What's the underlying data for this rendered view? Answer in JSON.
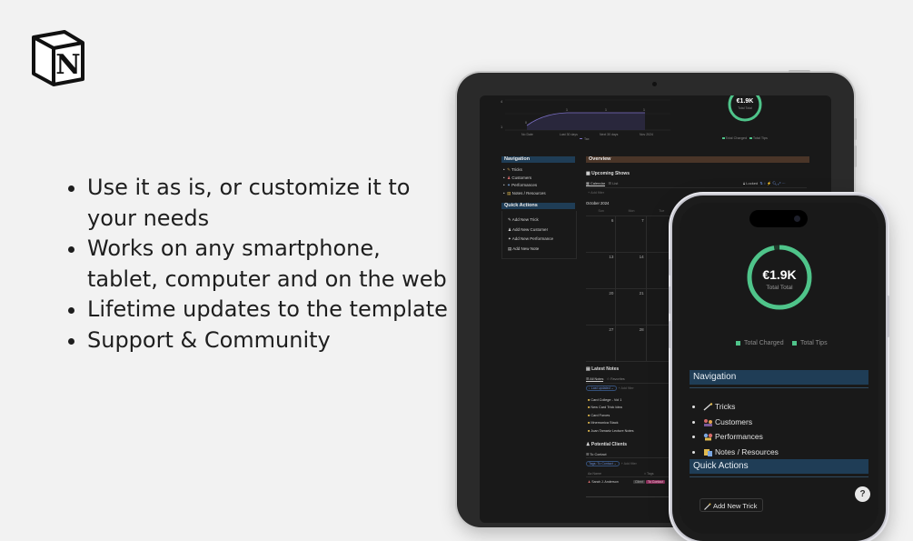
{
  "logo": {
    "icon": "notion-logo-icon",
    "letter": "N"
  },
  "bullets": [
    "Use it as is, or customize it to your needs",
    "Works on any smartphone, tablet, computer and on the web",
    "Lifetime updates to the template",
    "Support & Community"
  ],
  "colors": {
    "background": "#f2f2f2",
    "accent_green": "#4fc48a",
    "section_blue": "#1f3d56",
    "overview_brown": "#4a3528",
    "tag_pink": "#8a2e5a"
  },
  "tablet": {
    "chart": {
      "x_ticks": [
        "No Date",
        "Last 30 days",
        "Next 30 days",
        "Nov 2024"
      ],
      "y_ticks": [
        "4",
        "1"
      ],
      "point_labels": [
        "0",
        "1",
        "1",
        "1"
      ],
      "legend": "Tax"
    },
    "ring": {
      "value": "€1.9K",
      "label": "Total Total",
      "legend": [
        "Total Charged",
        "Total Tips"
      ]
    },
    "navigation": {
      "title": "Navigation",
      "items": [
        "Tricks",
        "Customers",
        "Performances",
        "Notes / Resources"
      ]
    },
    "quick_actions": {
      "title": "Quick Actions",
      "items": [
        "Add New Trick",
        "Add New Customer",
        "Add New Performance",
        "Add New Note"
      ]
    },
    "overview": {
      "title": "Overview",
      "upcoming": "Upcoming Shows",
      "view_tabs": [
        "Calendar",
        "List"
      ],
      "locked": "Locked",
      "add_filter": "+ Add filter",
      "month": "October 2024",
      "weekdays": [
        "Sun",
        "Mon",
        "Tue"
      ],
      "dates": [
        "6",
        "7",
        "",
        "13",
        "14",
        "",
        "20",
        "21",
        "",
        "27",
        "28",
        ""
      ]
    },
    "latest_notes": {
      "title": "Latest Notes",
      "tabs": [
        "All Notes",
        "Favorites"
      ],
      "filter": "Last updated",
      "add_filter": "+ Add filter",
      "items": [
        "Card College - Vol 1",
        "New Card Trick Idea",
        "Card Forces",
        "Mnemonica Stack",
        "Juan Tamariz Lecture Notes"
      ]
    },
    "potential_clients": {
      "title": "Potential Clients",
      "tab": "To Contact",
      "filter": "Tags: To Contact",
      "add_filter": "+ Add filter",
      "columns": [
        "Aa Name",
        "Tags"
      ],
      "row": {
        "name": "Sarah J. Anderson",
        "tag1": "Client",
        "tag2": "To Contact"
      }
    }
  },
  "phone": {
    "ring": {
      "value": "€1.9K",
      "label": "Total Total",
      "progress": 0.97
    },
    "legend": [
      "Total Charged",
      "Total Tips"
    ],
    "navigation": {
      "title": "Navigation",
      "items": [
        "Tricks",
        "Customers",
        "Performances",
        "Notes / Resources"
      ]
    },
    "quick_actions": {
      "title": "Quick Actions",
      "button": "Add New Trick"
    },
    "fab": "?"
  }
}
